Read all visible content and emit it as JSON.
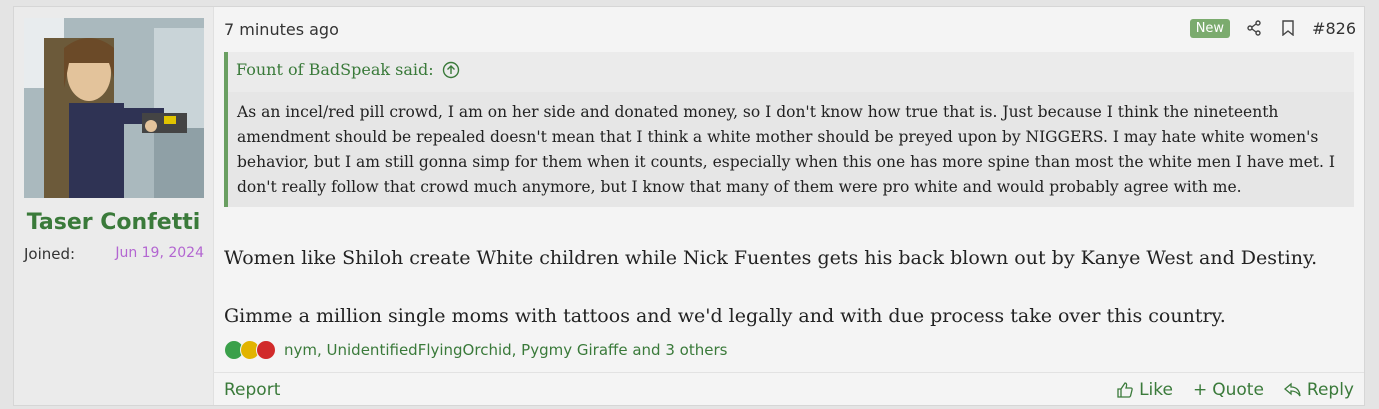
{
  "user": {
    "name": "Taser Confetti",
    "joined_label": "Joined:",
    "joined_date": "Jun 19, 2024"
  },
  "post": {
    "time": "7 minutes ago",
    "badge": "New",
    "number": "#826",
    "quote_author": "Fount of BadSpeak said:",
    "quote_text": "As an incel/red pill crowd, I am on her side and donated money, so I don't know how true that is. Just because I think the nineteenth amendment should be repealed doesn't mean that I think a white mother should be preyed upon by NIGGERS. I may hate white women's behavior, but I am still gonna simp for them when it counts, especially when this one has more spine than most the white men I have met. I don't really follow that crowd much anymore, but I know that many of them were pro white and would probably agree with me.",
    "body_line1": "Women like Shiloh create White children while Nick Fuentes gets his back blown out by Kanye West and Destiny.",
    "body_line2": "Gimme a million single moms with tattoos and we'd legally and with due process take over this country.",
    "reactions_text": "nym, UnidentifiedFlyingOrchid, Pygmy Giraffe and 3 others"
  },
  "footer": {
    "report": "Report",
    "like": "Like",
    "quote": "Quote",
    "reply": "Reply"
  },
  "colors": {
    "accent": "#3a7a3a",
    "badge": "#7bab6e",
    "joined_date": "#b366d1"
  }
}
